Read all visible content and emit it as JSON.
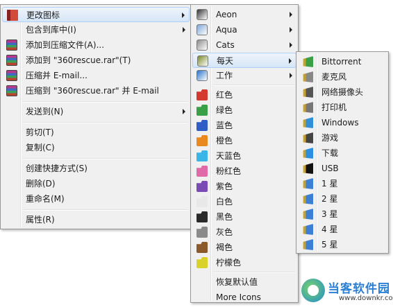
{
  "menu1": {
    "items": [
      {
        "label": "更改图标",
        "icon": "winrar-book-icon",
        "color": "#c0392b"
      },
      {
        "label": "包含到库中(I)"
      },
      {
        "label": "添加到压缩文件(A)...",
        "icon": "winrar-archive-icon"
      },
      {
        "label": "添加到 \"360rescue.rar\"(T)",
        "icon": "winrar-archive-icon"
      },
      {
        "label": "压缩并 E-mail...",
        "icon": "winrar-archive-icon"
      },
      {
        "label": "压缩到 \"360rescue.rar\" 并 E-mail",
        "icon": "winrar-archive-icon"
      },
      {
        "label": "发送到(N)"
      },
      {
        "label": "剪切(T)"
      },
      {
        "label": "复制(C)"
      },
      {
        "label": "创建快捷方式(S)"
      },
      {
        "label": "删除(D)"
      },
      {
        "label": "重命名(M)"
      },
      {
        "label": "属性(R)"
      }
    ]
  },
  "menu2": {
    "items": [
      {
        "label": "Aeon",
        "color": "#333333"
      },
      {
        "label": "Aqua",
        "color": "#7fa6d6"
      },
      {
        "label": "Cats",
        "color": "#8c8c8c"
      },
      {
        "label": "每天",
        "color": "#7a8a2a"
      },
      {
        "label": "工作",
        "color": "#2a74c8"
      },
      {
        "label": "红色",
        "color": "#d3392e"
      },
      {
        "label": "绿色",
        "color": "#3aa047"
      },
      {
        "label": "蓝色",
        "color": "#2f5fc6"
      },
      {
        "label": "橙色",
        "color": "#e88a1f"
      },
      {
        "label": "天蓝色",
        "color": "#3bb5e6"
      },
      {
        "label": "粉红色",
        "color": "#e06aa8"
      },
      {
        "label": "紫色",
        "color": "#7a4bb5"
      },
      {
        "label": "白色",
        "color": "#e8e8e8"
      },
      {
        "label": "黑色",
        "color": "#2a2a2a"
      },
      {
        "label": "灰色",
        "color": "#8a8a8a"
      },
      {
        "label": "褐色",
        "color": "#8a5a2b"
      },
      {
        "label": "柠檬色",
        "color": "#d8d22a"
      },
      {
        "label": "恢复默认值"
      },
      {
        "label": "More Icons"
      }
    ]
  },
  "menu3": {
    "items": [
      {
        "label": "Bittorrent",
        "color": "#3aa047"
      },
      {
        "label": "麦克风",
        "color": "#888888"
      },
      {
        "label": "网络摄像头",
        "color": "#555555"
      },
      {
        "label": "打印机",
        "color": "#777777"
      },
      {
        "label": "Windows",
        "color": "#2f8fd8"
      },
      {
        "label": "游戏",
        "color": "#444444"
      },
      {
        "label": "下载",
        "color": "#2a8fe0"
      },
      {
        "label": "USB",
        "color": "#111111"
      },
      {
        "label": "1 星",
        "color": "#3b7fd6"
      },
      {
        "label": "2 星",
        "color": "#3b7fd6"
      },
      {
        "label": "3 星",
        "color": "#3b7fd6"
      },
      {
        "label": "4 星",
        "color": "#3b7fd6"
      },
      {
        "label": "5 星",
        "color": "#3b7fd6"
      }
    ]
  },
  "watermark": {
    "title": "当客软件园",
    "url": "www.downkr.com"
  }
}
